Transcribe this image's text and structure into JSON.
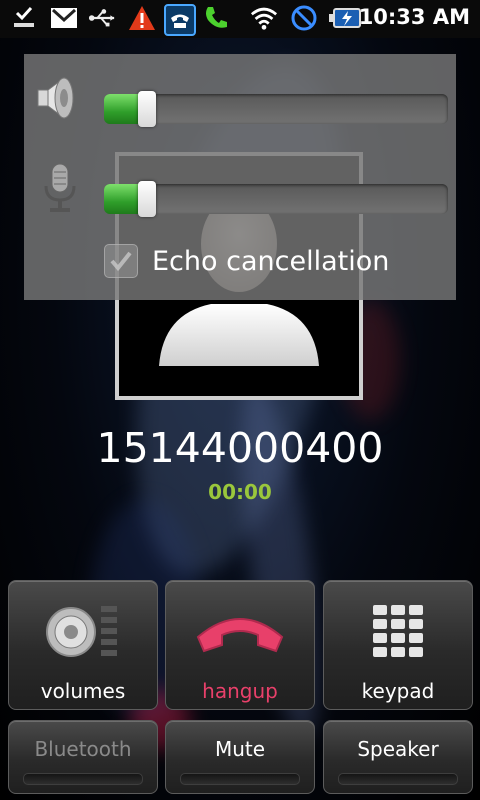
{
  "status_bar": {
    "time": "10:33 AM",
    "icons": [
      "notification-check-icon",
      "gmail-icon",
      "usb-icon",
      "warning-icon",
      "call-active-icon",
      "phone-icon",
      "wifi-icon",
      "no-signal-icon",
      "battery-charging-icon"
    ]
  },
  "volume_panel": {
    "speaker_volume_level": 0.1,
    "mic_volume_level": 0.1,
    "echo_cancellation_label": "Echo cancellation",
    "echo_cancellation_checked": true
  },
  "call": {
    "number": "15144000400",
    "timer": "00:00"
  },
  "buttons": {
    "volumes": "volumes",
    "hangup": "hangup",
    "keypad": "keypad",
    "bluetooth": "Bluetooth",
    "mute": "Mute",
    "speaker": "Speaker"
  },
  "colors": {
    "hangup_red": "#e8406a",
    "timer_green": "#9ac73c",
    "slider_green": "#3aa834",
    "disabled_text": "#8a8a8a"
  }
}
